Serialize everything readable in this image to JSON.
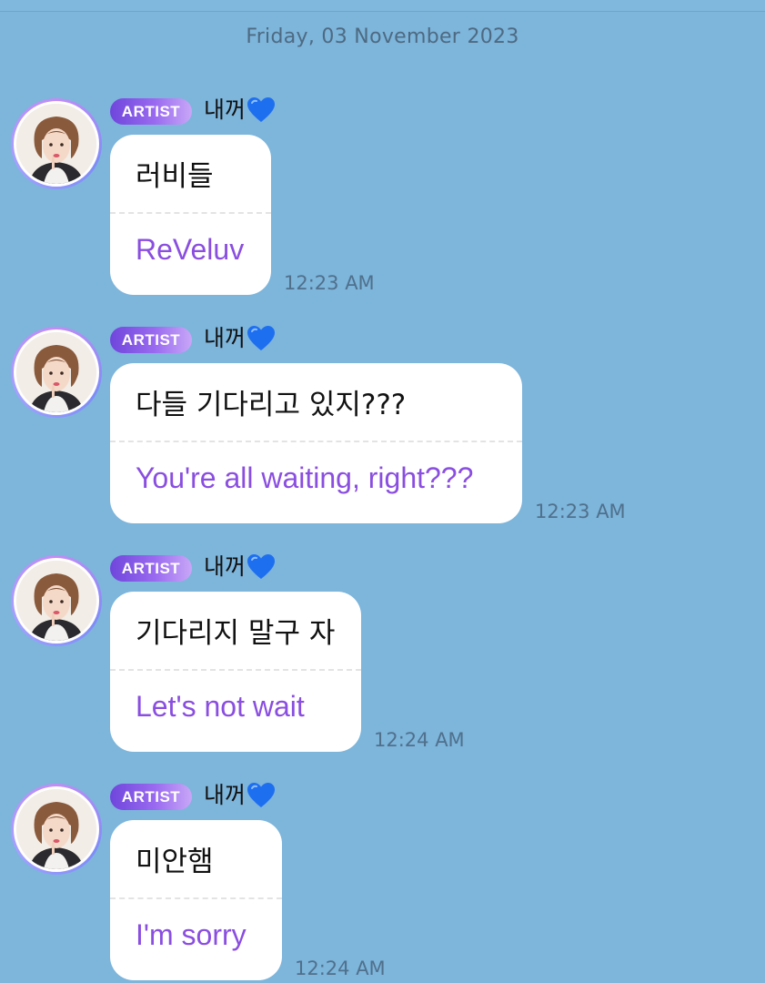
{
  "date_header": "Friday, 03 November 2023",
  "messages": [
    {
      "badge": "ARTIST",
      "sender": "내꺼",
      "text_ko": "러비들",
      "text_en": "ReVeluv",
      "time": "12:23 AM"
    },
    {
      "badge": "ARTIST",
      "sender": "내꺼",
      "text_ko": "다들 기다리고 있지???",
      "text_en": "You're all waiting, right???",
      "time": "12:23 AM"
    },
    {
      "badge": "ARTIST",
      "sender": "내꺼",
      "text_ko": "기다리지 말구 자",
      "text_en": "Let's not wait",
      "time": "12:24 AM"
    },
    {
      "badge": "ARTIST",
      "sender": "내꺼",
      "text_ko": "미안햄",
      "text_en": "I'm sorry",
      "time": "12:24 AM"
    }
  ],
  "icons": {
    "sender_emoji": "blue-heart-icon",
    "avatar": "artist-avatar-photo"
  },
  "colors": {
    "background": "#7db5db",
    "badge_gradient_start": "#6f46dc",
    "badge_gradient_end": "#c8a7f7",
    "translation_text": "#8a4ee0",
    "heart": "#1e6ff0"
  }
}
